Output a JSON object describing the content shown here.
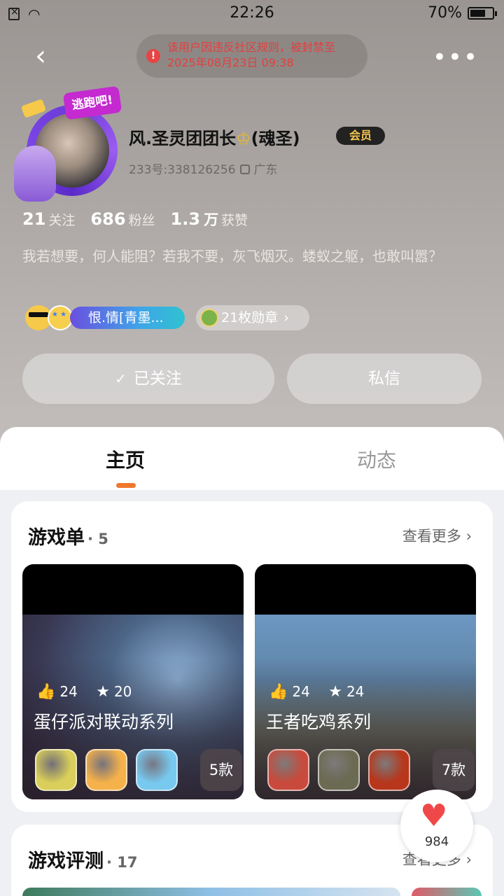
{
  "status_bar": {
    "time": "22:26",
    "battery": "70%",
    "battery_level": 0.7
  },
  "ban_notice": {
    "line1": "该用户因违反社区规则，被封禁至",
    "line2": "2025年08月23日 09:38"
  },
  "profile": {
    "avatar_badge_text": "逃跑吧!",
    "name": "风.圣灵团团长",
    "name_suffix": "(魂圣)",
    "crown_glyph": "♔",
    "vip_label": "会员",
    "id_label": "233号:338126256",
    "location": "广东",
    "stats": [
      {
        "num": "21",
        "label": "关注"
      },
      {
        "num": "686",
        "label": "粉丝"
      },
      {
        "num": "1.3",
        "unit": "万",
        "label": "获赞"
      }
    ],
    "bio": "我若想要，何人能阻？若我不要，灰飞烟灭。蝼蚁之躯，也敢叫嚣？",
    "nameplate": "恨.情[青墨...",
    "medals": "21枚勋章",
    "medal_chevron": "›"
  },
  "actions": {
    "follow": "已关注",
    "follow_icon": "✓",
    "message": "私信"
  },
  "tabs": {
    "home": "主页",
    "feed": "动态"
  },
  "game_lists": {
    "title": "游戏单",
    "count": "· 5",
    "see_more": "查看更多 ›",
    "items": [
      {
        "likes": "24",
        "stars": "20",
        "name": "蛋仔派对联动系列",
        "count": "5款",
        "icon_colors": [
          "#d9cf5a",
          "#f6b24a",
          "#78c9ef"
        ]
      },
      {
        "likes": "24",
        "stars": "24",
        "name": "王者吃鸡系列",
        "count": "7款",
        "icon_colors": [
          "#c94a3c",
          "#6b6a52",
          "#b8361c"
        ]
      }
    ]
  },
  "reviews": {
    "title": "游戏评测",
    "count": "· 17",
    "see_more": "查看更多 ›"
  },
  "like_button": {
    "count": "984"
  },
  "icons": {
    "back": "‹",
    "more": "•••",
    "ban": "!",
    "wifi": "◠",
    "thumb": "👍",
    "star": "★",
    "heart": "♥"
  }
}
